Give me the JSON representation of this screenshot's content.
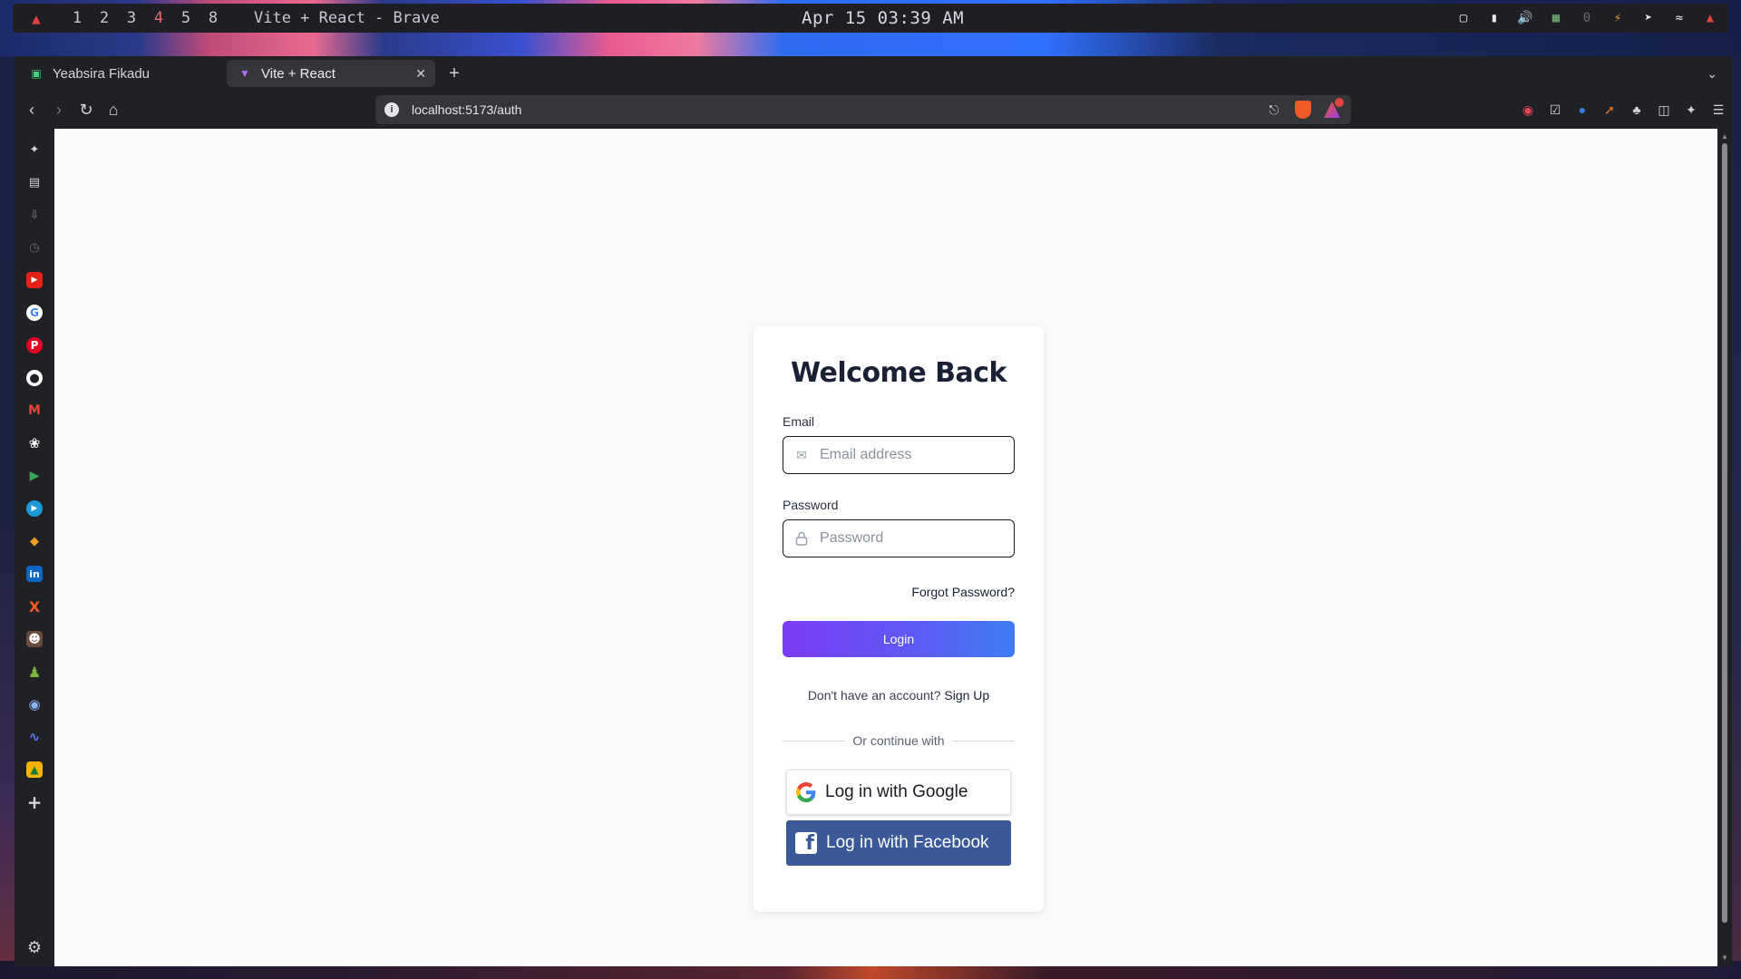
{
  "system_bar": {
    "workspaces": [
      "1",
      "2",
      "3",
      "4",
      "5",
      "8"
    ],
    "active_workspace": "4",
    "window_title": "Vite + React - Brave",
    "clock": "Apr 15 03:39 AM"
  },
  "browser": {
    "tabs": [
      {
        "label": "Yeabsira Fikadu",
        "active": false
      },
      {
        "label": "Vite + React",
        "active": true
      }
    ],
    "url": "localhost:5173/auth"
  },
  "auth": {
    "title": "Welcome Back",
    "email_label": "Email",
    "email_placeholder": "Email address",
    "password_label": "Password",
    "password_placeholder": "Password",
    "forgot_password": "Forgot Password?",
    "login_button": "Login",
    "no_account_text": "Don't have an account?",
    "signup_link": "Sign Up",
    "divider_text": "Or continue with",
    "google_button": "Log in with Google",
    "facebook_button": "Log in with Facebook"
  },
  "colors": {
    "login_gradient_start": "#7b3cf5",
    "login_gradient_end": "#3e7cf5",
    "facebook_blue": "#3b5998",
    "page_background": "#f8f9fb"
  },
  "sidebar_icons": [
    "leo-icon",
    "bookmarks-icon",
    "downloads-icon",
    "history-icon",
    "youtube-icon",
    "google-icon",
    "pinterest-icon",
    "github-icon",
    "gmail-icon",
    "openai-icon",
    "play-icon",
    "media-play-icon",
    "code-icon",
    "linkedin-icon",
    "x-icon",
    "avatar-icon",
    "chess-icon",
    "globe-icon",
    "wave-icon",
    "photos-icon",
    "add-icon",
    "settings-icon"
  ]
}
